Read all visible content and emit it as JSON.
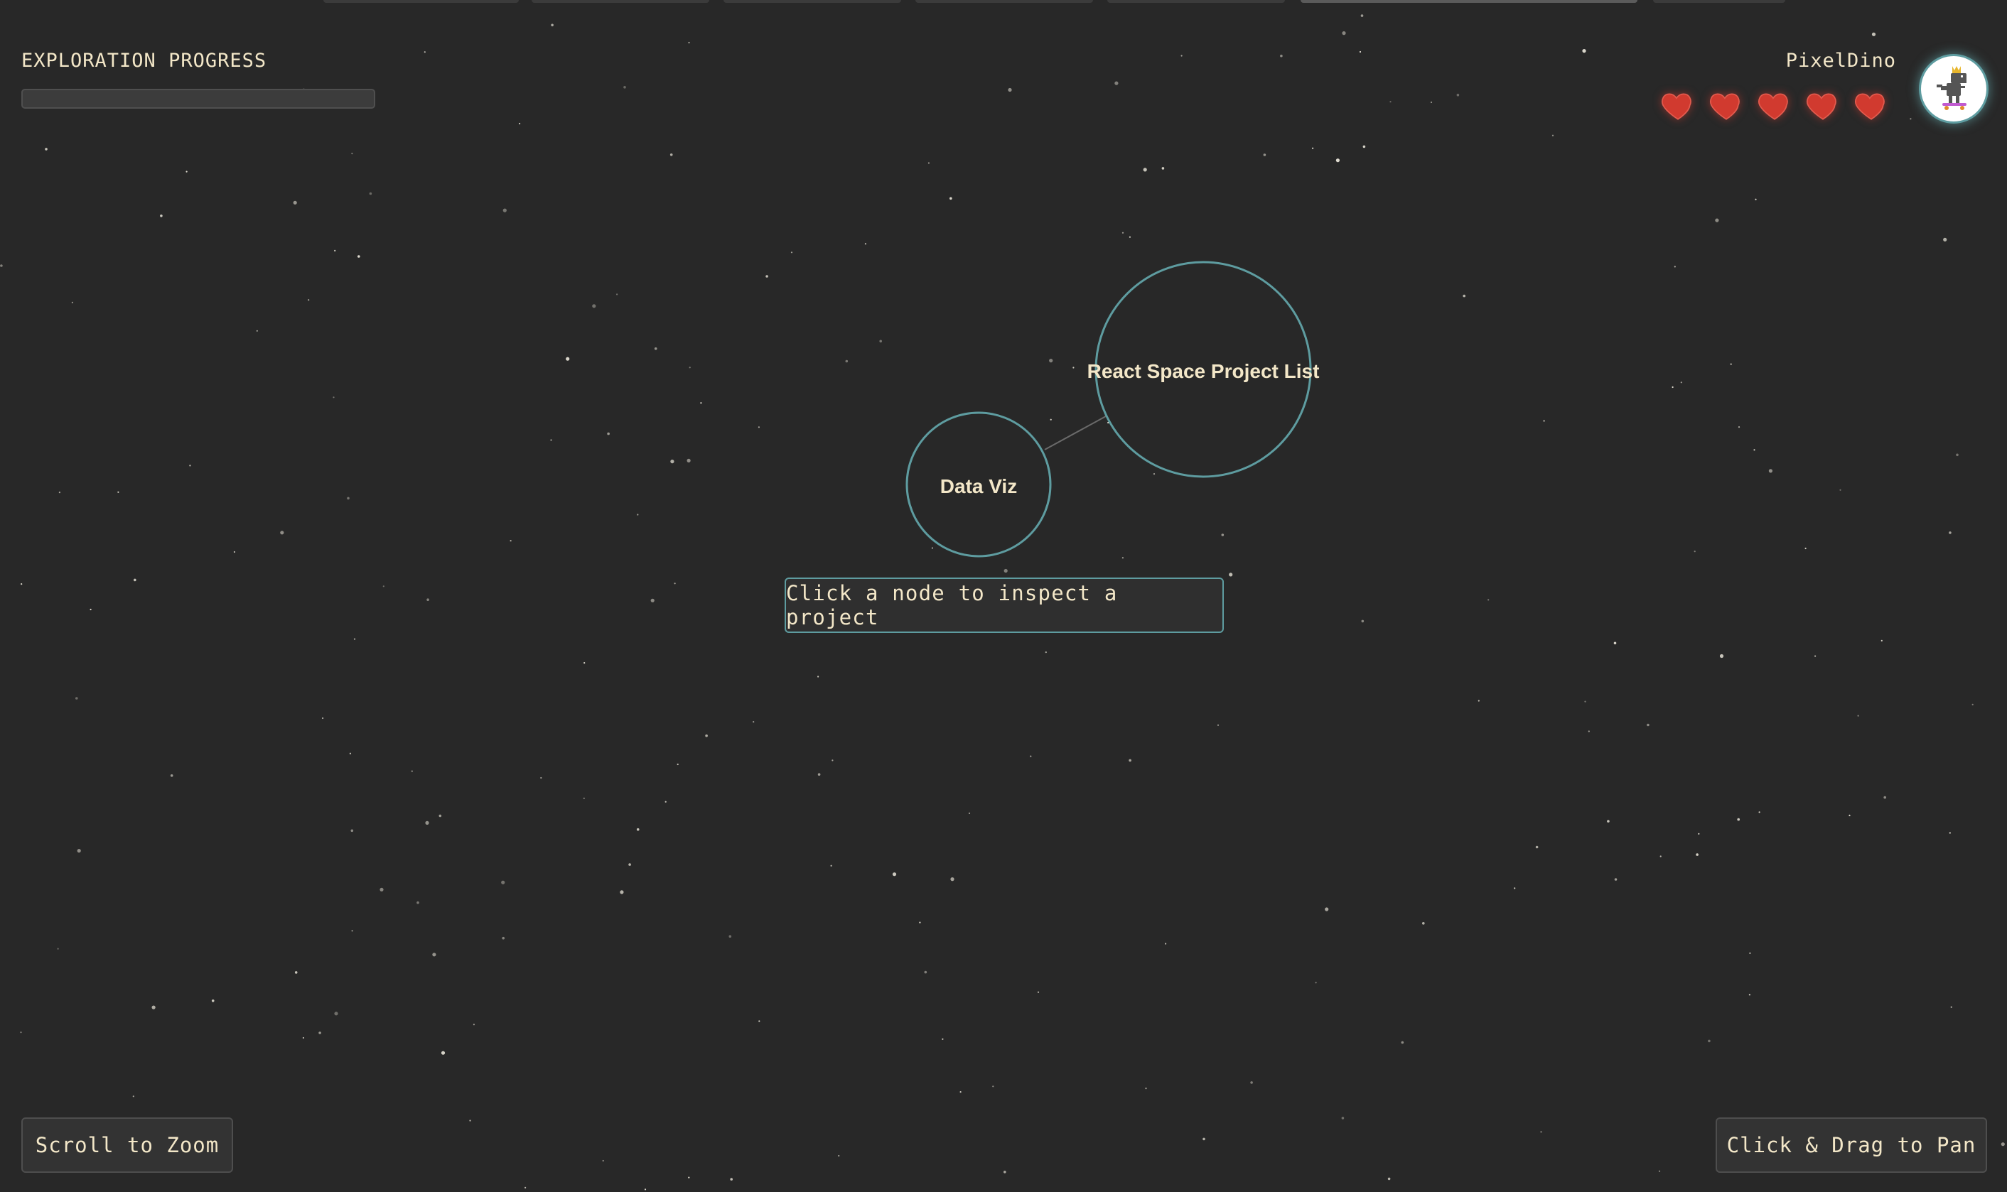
{
  "header": {
    "progress_label": "EXPLORATION PROGRESS",
    "progress_fraction": 0.0,
    "username": "PixelDino",
    "lives": 5
  },
  "graph": {
    "nodes": [
      {
        "id": "react-space-project-list",
        "label": "React Space Project List"
      },
      {
        "id": "data-viz",
        "label": "Data Viz"
      }
    ],
    "edges": [
      {
        "from": "data-viz",
        "to": "react-space-project-list"
      }
    ]
  },
  "hint": {
    "text": "Click a node to inspect a project"
  },
  "controls": {
    "zoom_label": "Scroll to Zoom",
    "pan_label": "Click & Drag to Pan"
  },
  "colors": {
    "background": "#282828",
    "accent": "#5e9ca0",
    "text": "#f3e7c8",
    "heart": "#d13a2f"
  },
  "icons": {
    "life": "heart-icon",
    "avatar": "dino-avatar-icon"
  }
}
